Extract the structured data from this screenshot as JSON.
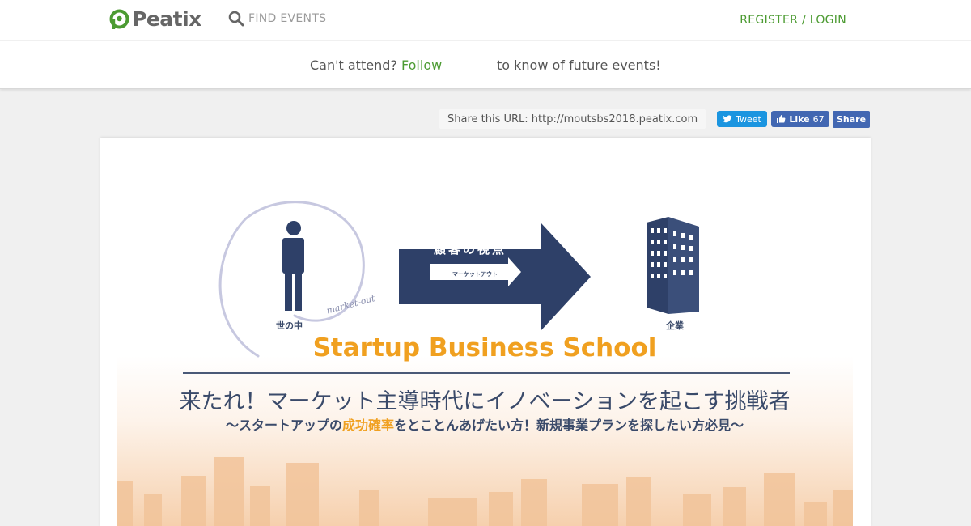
{
  "nav": {
    "logo_text": "Peatix",
    "find_label": "FIND EVENTS",
    "register_label": "REGISTER / LOGIN",
    "brand_color": "#4c9b32"
  },
  "follow_bar": {
    "prefix": "Can't attend?",
    "link": "Follow",
    "suffix": "to know of future events!"
  },
  "share": {
    "url_text": "Share this URL: http://moutsbs2018.peatix.com",
    "tweet_label": "Tweet",
    "like_label": "Like",
    "like_count": "67",
    "share_label": "Share"
  },
  "banner": {
    "left_caption": "世の中",
    "arrow_text": "顧客の視点",
    "arrow_subtext": "マーケットアウト",
    "right_caption": "企業",
    "script_text": "market-out",
    "title": "Startup Business School",
    "headline": "来たれ！マーケット主導時代にイノベーションを起こす挑戦者",
    "sub_prefix": "〜スタートアップの",
    "sub_highlight": "成功確率",
    "sub_suffix": "をとことんあげたい方！新規事業プランを探したい方必見〜",
    "title_color": "#f0a020",
    "navy_color": "#2e4068"
  }
}
